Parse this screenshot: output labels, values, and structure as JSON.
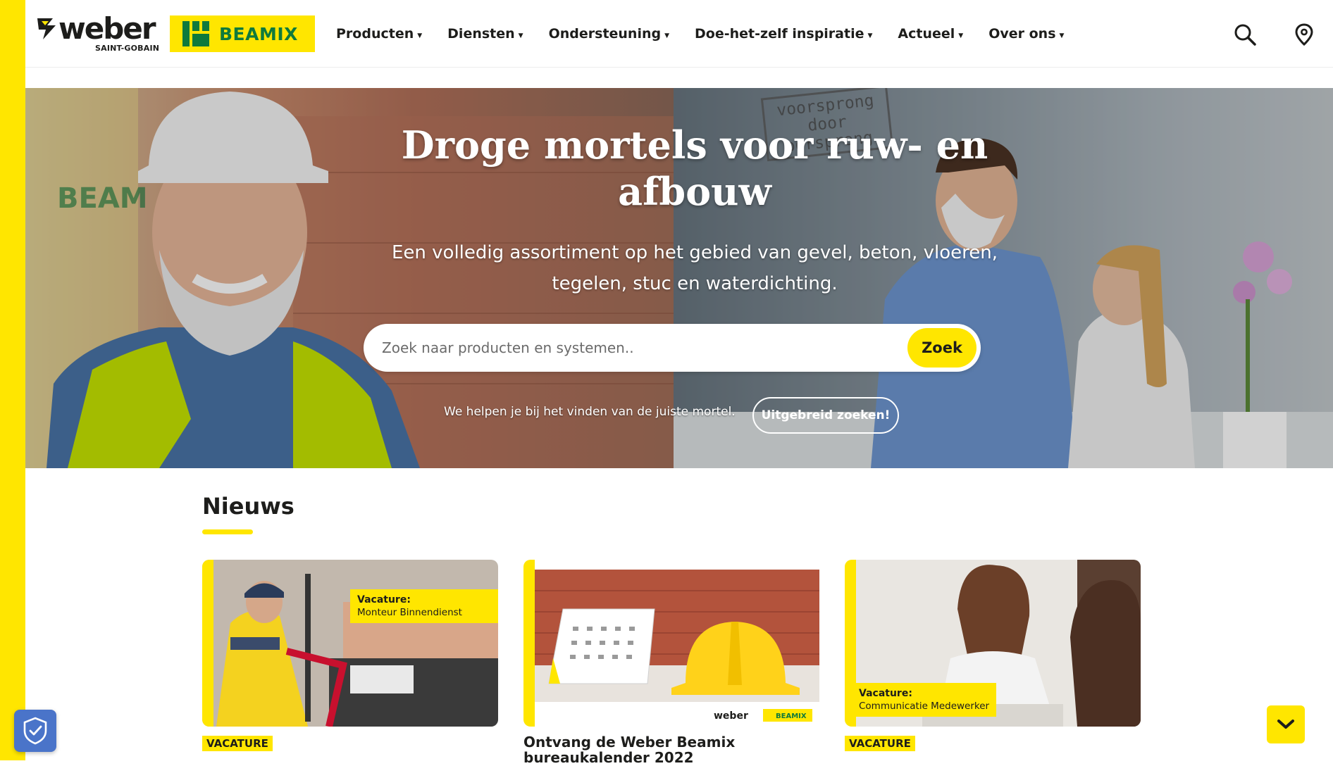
{
  "brand": {
    "weber_word": "weber",
    "weber_sub": "SAINT-GOBAIN",
    "beamix_word": "BEAMIX",
    "yellow": "#ffe600",
    "green": "#0f7a3c"
  },
  "nav": {
    "items": [
      {
        "label": "Producten"
      },
      {
        "label": "Diensten"
      },
      {
        "label": "Ondersteuning"
      },
      {
        "label": "Doe-het-zelf inspiratie"
      },
      {
        "label": "Actueel"
      },
      {
        "label": "Over ons"
      }
    ],
    "search_icon": "search-icon",
    "location_icon": "location-pin-icon"
  },
  "hero": {
    "title": "Droge mortels voor ruw- en afbouw",
    "lead": "Een volledig assortiment op het gebied van gevel, beton, vloeren, tegelen, stuc en waterdichting.",
    "search_placeholder": "Zoek naar producten en systemen..",
    "search_button": "Zoek",
    "help_text": "We helpen je bij het vinden van de juiste mortel.",
    "advanced_button": "Uitgebreid zoeken!",
    "stamp_text": "voorsprong door oorsprong"
  },
  "news": {
    "title": "Nieuws",
    "cards": [
      {
        "overlay_type": "Vacature:",
        "overlay_title": "Monteur Binnendienst",
        "badge": "VACATURE"
      },
      {
        "title": "Ontvang de Weber Beamix bureaukalender 2022"
      },
      {
        "overlay_type": "Vacature:",
        "overlay_title": "Communicatie Medewerker",
        "badge": "VACATURE"
      }
    ]
  },
  "widgets": {
    "cookie_icon": "shield-check-icon",
    "scroll_icon": "chevron-down-icon"
  }
}
